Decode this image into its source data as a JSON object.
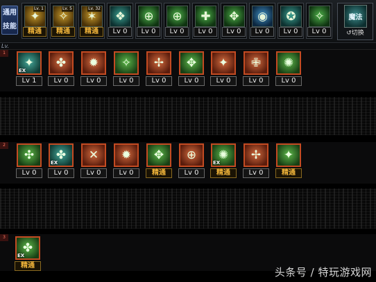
{
  "header": {
    "common_skill_label": "通用技能",
    "common_skill_line1": "通用",
    "common_skill_line2": "技能",
    "swap": {
      "icon_text": "魔法",
      "label": "切换"
    }
  },
  "top_slots": [
    {
      "level": "精通",
      "tag": "Lv. 1",
      "icon": "✦"
    },
    {
      "level": "精通",
      "tag": "Lv. 5",
      "icon": "✧"
    },
    {
      "level": "精通",
      "tag": "Lv. 32",
      "icon": "✶"
    },
    {
      "level": "Lv 0",
      "icon": "❖"
    },
    {
      "level": "Lv 0",
      "icon": "⊕"
    },
    {
      "level": "Lv 0",
      "icon": "⊕"
    },
    {
      "level": "Lv 0",
      "icon": "✚"
    },
    {
      "level": "Lv 0",
      "icon": "✥"
    },
    {
      "level": "Lv 0",
      "icon": "◉"
    },
    {
      "level": "Lv 0",
      "icon": "✪"
    },
    {
      "level": "Lv 0",
      "icon": "✧"
    }
  ],
  "lv_header": "Lv.",
  "rows": [
    {
      "marker": "1",
      "skills": [
        {
          "level": "Lv 1",
          "ex": "EX",
          "icon": "✦"
        },
        {
          "level": "Lv 0",
          "icon": "✤"
        },
        {
          "level": "Lv 0",
          "icon": "✹"
        },
        {
          "level": "Lv 0",
          "icon": "✧"
        },
        {
          "level": "Lv 0",
          "icon": "✢"
        },
        {
          "level": "Lv 0",
          "icon": "✥"
        },
        {
          "level": "Lv 0",
          "icon": "✦"
        },
        {
          "level": "Lv 0",
          "icon": "✙"
        },
        {
          "level": "Lv 0",
          "icon": "✺"
        }
      ]
    },
    {
      "marker": "2",
      "skills": [
        {
          "level": "Lv 0",
          "icon": "✣"
        },
        {
          "level": "Lv 0",
          "ex": "EX",
          "icon": "✤"
        },
        {
          "level": "Lv 0",
          "icon": "✕"
        },
        {
          "level": "Lv 0",
          "icon": "✹"
        },
        {
          "level": "精通",
          "icon": "✥"
        },
        {
          "level": "Lv 0",
          "icon": "⊕"
        },
        {
          "level": "精通",
          "ex": "EX",
          "icon": "✺"
        },
        {
          "level": "Lv 0",
          "icon": "✢"
        },
        {
          "level": "精通",
          "icon": "✦"
        }
      ]
    },
    {
      "marker": "3",
      "skills": [
        {
          "level": "精通",
          "ex": "EX",
          "icon": "✤"
        }
      ]
    }
  ],
  "watermark": "头条号 / 特玩游戏网"
}
